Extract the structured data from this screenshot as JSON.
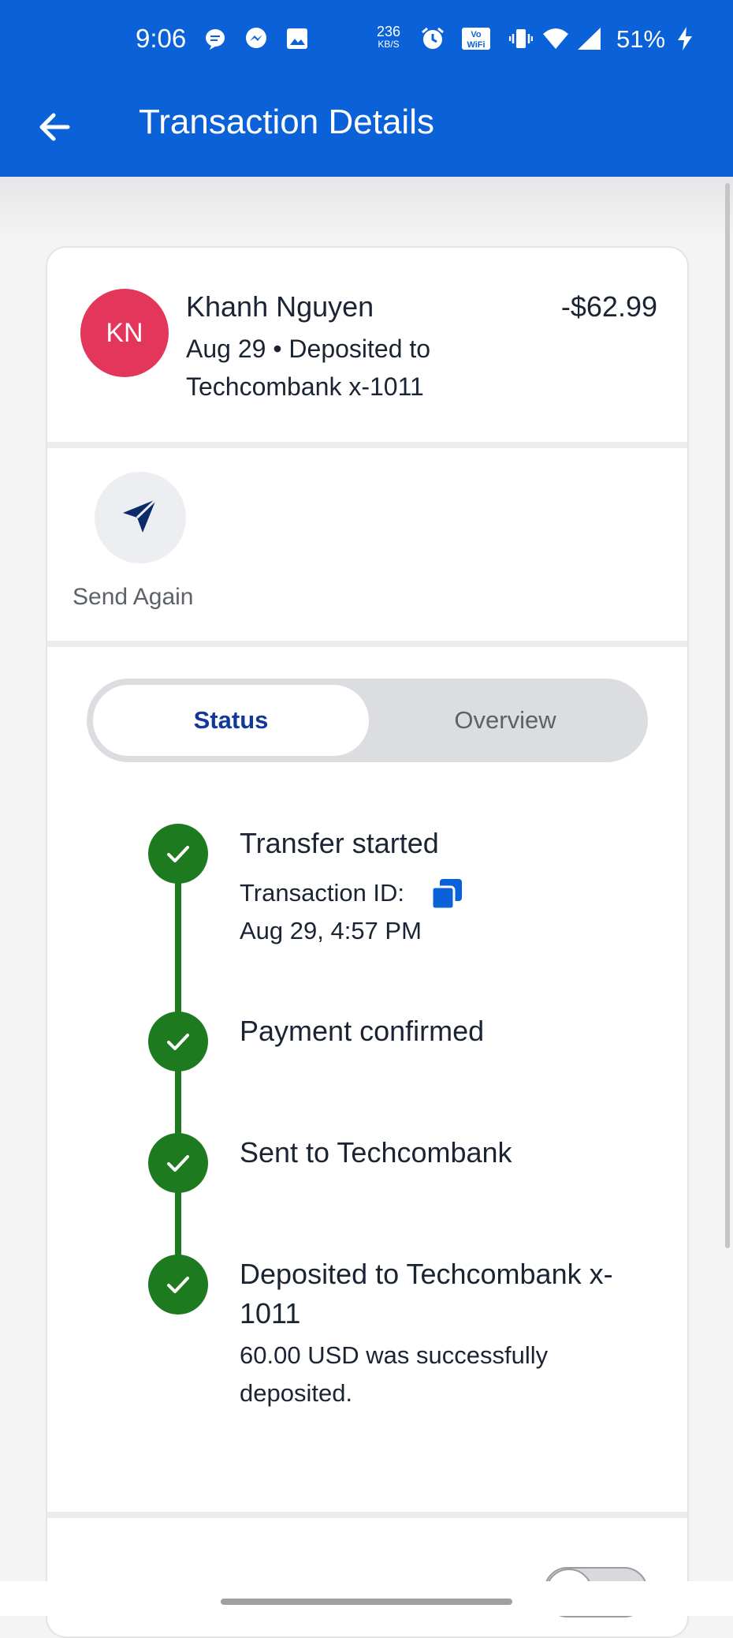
{
  "status_bar": {
    "time": "9:06",
    "speed_value": "236",
    "speed_unit": "KB/S",
    "battery": "51%",
    "icons": [
      "message-icon",
      "messenger-icon",
      "gallery-icon",
      "alarm-icon",
      "vowifi-icon",
      "vibrate-icon",
      "wifi-icon",
      "signal-icon",
      "charging-icon"
    ]
  },
  "app_bar": {
    "title": "Transaction Details",
    "back_icon": "arrow-left-icon"
  },
  "transaction": {
    "avatar_initials": "KN",
    "avatar_color": "#e3365a",
    "name": "Khanh Nguyen",
    "amount": "-$62.99",
    "subtitle_line1": "Aug 29 • Deposited to",
    "subtitle_line2": "Techcombank x-1011"
  },
  "actions": {
    "send_again_label": "Send Again"
  },
  "tabs": {
    "status": "Status",
    "overview": "Overview",
    "selected": "Status"
  },
  "timeline": {
    "color": "#1e7a1e",
    "steps": [
      {
        "title": "Transfer started",
        "detail_1": "Transaction ID:",
        "detail_2": "Aug 29, 4:57 PM"
      },
      {
        "title": "Payment confirmed"
      },
      {
        "title": "Sent to Techcombank"
      },
      {
        "title_1": "Deposited to Techcombank x-",
        "title_2": "1011",
        "detail_1": "60.00 USD was successfully",
        "detail_2": "deposited."
      }
    ]
  },
  "colors": {
    "primary": "#0a61d8",
    "tab_active_text": "#12389a"
  }
}
